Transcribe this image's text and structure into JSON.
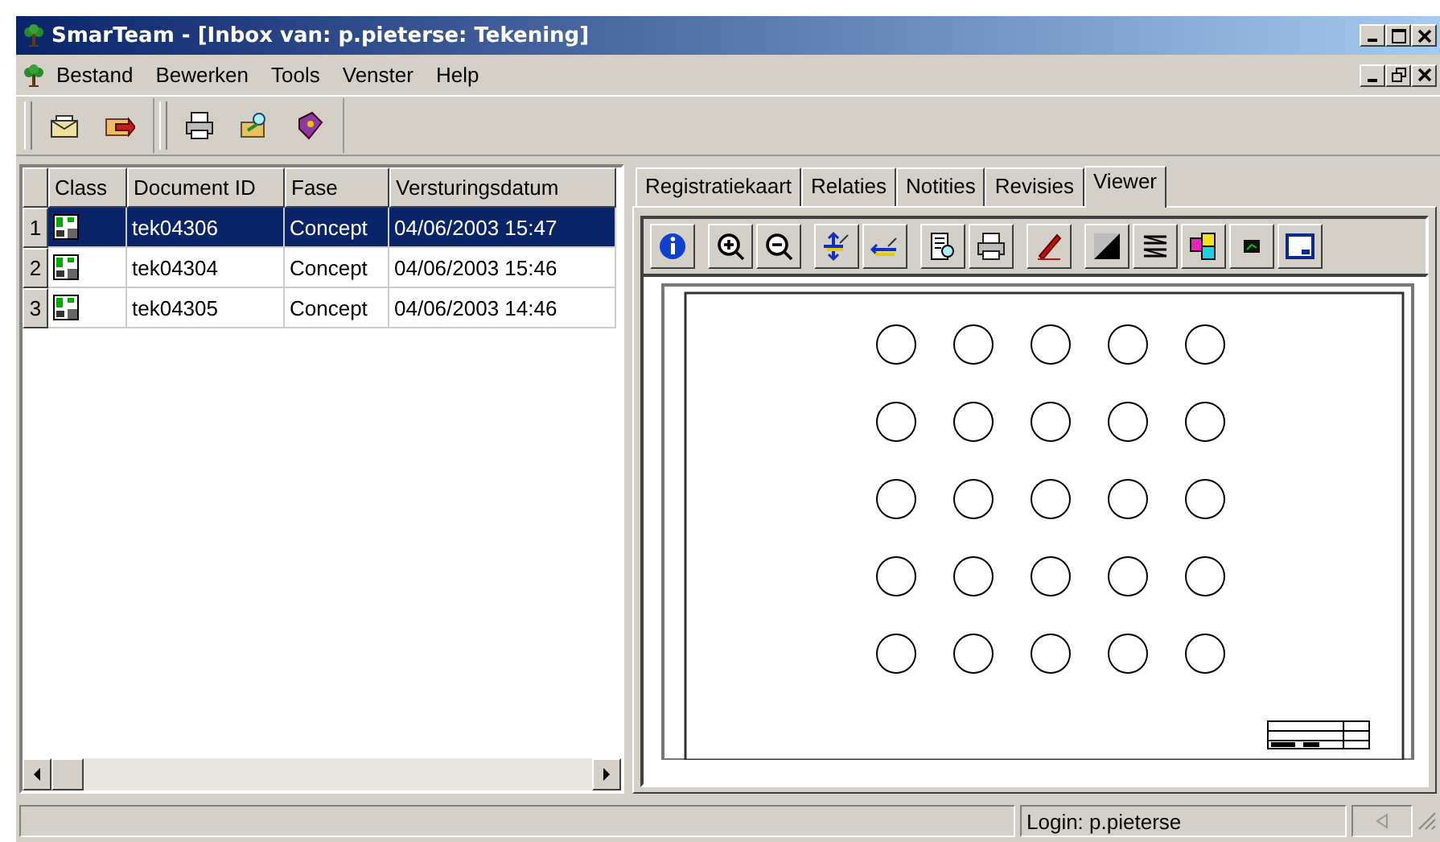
{
  "window": {
    "title": "SmarTeam - [Inbox van: p.pieterse: Tekening]"
  },
  "menu": [
    {
      "label": "Bestand"
    },
    {
      "label": "Bewerken"
    },
    {
      "label": "Tools"
    },
    {
      "label": "Venster"
    },
    {
      "label": "Help"
    }
  ],
  "table": {
    "columns": [
      "Class",
      "Document ID",
      "Fase",
      "Versturingsdatum"
    ],
    "rows": [
      {
        "number": "1",
        "document_id": "tek04306",
        "fase": "Concept",
        "datum": "04/06/2003 15:47",
        "selected": true
      },
      {
        "number": "2",
        "document_id": "tek04304",
        "fase": "Concept",
        "datum": "04/06/2003 15:46",
        "selected": false
      },
      {
        "number": "3",
        "document_id": "tek04305",
        "fase": "Concept",
        "datum": "04/06/2003 14:46",
        "selected": false
      }
    ]
  },
  "tabs": [
    {
      "label": "Registratiekaart",
      "selected": false
    },
    {
      "label": "Relaties",
      "selected": false
    },
    {
      "label": "Notities",
      "selected": false
    },
    {
      "label": "Revisies",
      "selected": false
    },
    {
      "label": "Viewer",
      "selected": true
    }
  ],
  "status_bar": {
    "login": "Login: p.pieterse"
  }
}
